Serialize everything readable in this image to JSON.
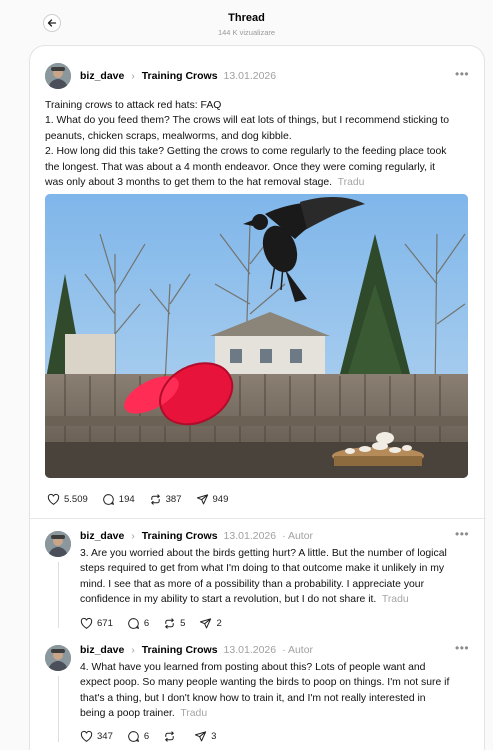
{
  "header": {
    "title": "Thread",
    "subtitle": "144 K vizualizare"
  },
  "main_post": {
    "username": "biz_dave",
    "community": "Training Crows",
    "date": "13.01.2026",
    "text_lines": [
      "Training crows to attack red hats: FAQ",
      "1. What do you feed them? The crows will eat lots of things, but I recommend sticking to",
      "peanuts, chicken scraps, mealworms, and dog kibble.",
      "2. How long did this take? Getting the crows to come regularly to the feeding place took",
      "the longest. That was about a 4 month endeavor. Once they were coming regularly, it",
      "was only about 3 months to get them to the hat removal stage."
    ],
    "translate": "Tradu",
    "likes": "5.509",
    "replies": "194",
    "reposts": "387",
    "shares": "949"
  },
  "replies": [
    {
      "username": "biz_dave",
      "community": "Training Crows",
      "date": "13.01.2026",
      "author_tag": "· Autor",
      "text_lines": [
        "3. Are you worried about the birds getting hurt? A little. But the number of logical",
        "steps required to get from what I'm doing to that outcome make it unlikely in my",
        "mind. I see that as more of a possibility than a probability. I appreciate your",
        "confidence in my ability to start a revolution, but I do not share it."
      ],
      "translate": "Tradu",
      "likes": "671",
      "replies": "6",
      "reposts": "5",
      "shares": "2"
    },
    {
      "username": "biz_dave",
      "community": "Training Crows",
      "date": "13.01.2026",
      "author_tag": "· Autor",
      "text_lines": [
        "4. What have you learned from posting about this? Lots of people want and",
        "expect poop. So many people wanting the birds to poop on things. I'm not sure if",
        "that's a thing, but I don't know how to train it, and I'm not really interested in",
        "being a poop trainer."
      ],
      "translate": "Tradu",
      "likes": "347",
      "replies": "6",
      "reposts": "",
      "shares": "3"
    }
  ],
  "icons": {
    "back": "arrow-left-icon",
    "more": "more-horizontal-icon",
    "like": "heart-icon",
    "reply": "comment-icon",
    "repost": "repost-icon",
    "share": "send-icon"
  },
  "colors": {
    "hat_red": "#e8133a",
    "sky": "#8ec0ea",
    "muted_text": "#a0a0a0"
  }
}
